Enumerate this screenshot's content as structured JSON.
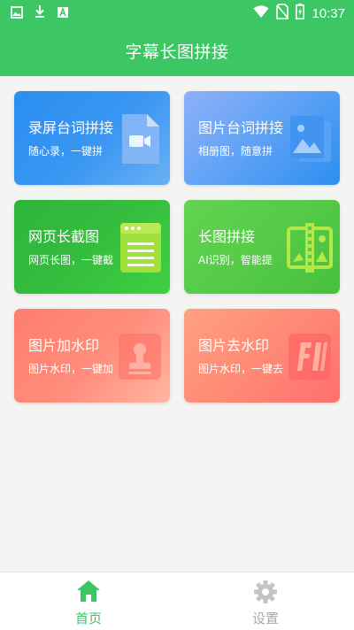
{
  "status_bar": {
    "time": "10:37"
  },
  "header": {
    "title": "字幕长图拼接"
  },
  "cards": [
    {
      "title": "录屏台词拼接",
      "subtitle": "随心录，一键拼",
      "icon": "video-file-icon"
    },
    {
      "title": "图片台词拼接",
      "subtitle": "相册图，随意拼",
      "icon": "image-stack-icon"
    },
    {
      "title": "网页长截图",
      "subtitle": "网页长图，一键截",
      "icon": "webpage-icon"
    },
    {
      "title": "长图拼接",
      "subtitle": "AI识别，智能提",
      "icon": "image-merge-icon"
    },
    {
      "title": "图片加水印",
      "subtitle": "图片水印，一键加",
      "icon": "stamp-icon"
    },
    {
      "title": "图片去水印",
      "subtitle": "图片水印，一键去",
      "icon": "erase-watermark-icon"
    }
  ],
  "bottom_nav": [
    {
      "label": "首页",
      "icon": "home-icon",
      "active": true
    },
    {
      "label": "设置",
      "icon": "gear-icon",
      "active": false
    }
  ],
  "colors": {
    "primary": "#3cc764",
    "inactive": "#aaaaaa"
  }
}
